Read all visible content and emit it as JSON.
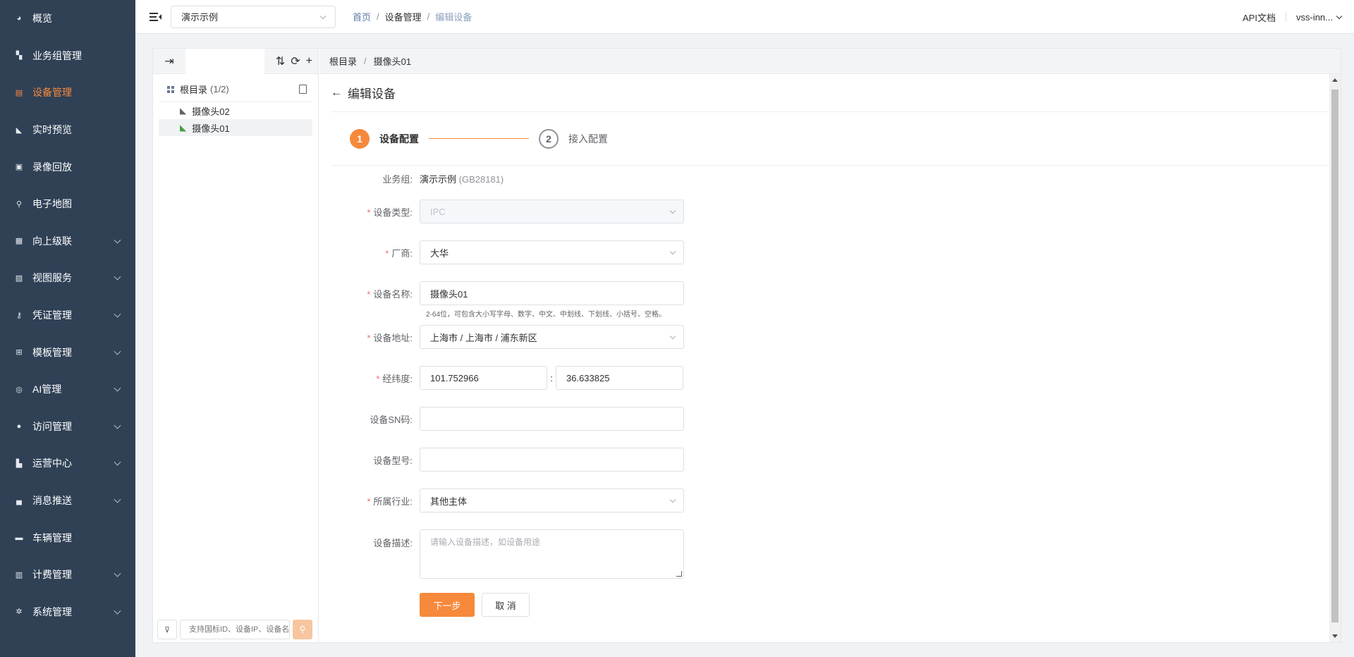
{
  "sidebar": {
    "items": [
      {
        "label": "概览",
        "icon": "dashboard-icon",
        "glyph": "◕",
        "expandable": false,
        "active": false
      },
      {
        "label": "业务组管理",
        "icon": "org-icon",
        "glyph": "▚",
        "expandable": false,
        "active": false
      },
      {
        "label": "设备管理",
        "icon": "device-icon",
        "glyph": "▤",
        "expandable": false,
        "active": true
      },
      {
        "label": "实时预览",
        "icon": "camera-icon",
        "glyph": "◣",
        "expandable": false,
        "active": false
      },
      {
        "label": "录像回放",
        "icon": "video-icon",
        "glyph": "▣",
        "expandable": false,
        "active": false
      },
      {
        "label": "电子地图",
        "icon": "map-pin-icon",
        "glyph": "⚲",
        "expandable": false,
        "active": false
      },
      {
        "label": "向上级联",
        "icon": "cascade-icon",
        "glyph": "▦",
        "expandable": true,
        "active": false
      },
      {
        "label": "视图服务",
        "icon": "image-icon",
        "glyph": "▨",
        "expandable": true,
        "active": false
      },
      {
        "label": "凭证管理",
        "icon": "key-icon",
        "glyph": "⚷",
        "expandable": true,
        "active": false
      },
      {
        "label": "模板管理",
        "icon": "template-icon",
        "glyph": "⊞",
        "expandable": true,
        "active": false
      },
      {
        "label": "AI管理",
        "icon": "ai-icon",
        "glyph": "◎",
        "expandable": true,
        "active": false
      },
      {
        "label": "访问管理",
        "icon": "user-icon",
        "glyph": "●",
        "expandable": true,
        "active": false
      },
      {
        "label": "运营中心",
        "icon": "building-icon",
        "glyph": "▙",
        "expandable": true,
        "active": false
      },
      {
        "label": "消息推送",
        "icon": "inbox-icon",
        "glyph": "▄",
        "expandable": true,
        "active": false
      },
      {
        "label": "车辆管理",
        "icon": "car-icon",
        "glyph": "▬",
        "expandable": false,
        "active": false
      },
      {
        "label": "计费管理",
        "icon": "billing-icon",
        "glyph": "▥",
        "expandable": true,
        "active": false
      },
      {
        "label": "系统管理",
        "icon": "settings-icon",
        "glyph": "✲",
        "expandable": true,
        "active": false
      }
    ]
  },
  "topbar": {
    "org_select": "演示示例",
    "breadcrumb": [
      "首页",
      "设备管理",
      "编辑设备"
    ],
    "api_docs": "API文档",
    "user": "vss-inn..."
  },
  "tree": {
    "root_label": "根目录",
    "root_count": "(1/2)",
    "nodes": [
      {
        "label": "摄像头02",
        "online": false,
        "selected": false
      },
      {
        "label": "摄像头01",
        "online": true,
        "selected": true
      }
    ],
    "search_placeholder": "支持国标ID、设备IP、设备名称"
  },
  "right_breadcrumb": [
    "根目录",
    "摄像头01"
  ],
  "edit": {
    "title": "编辑设备",
    "steps": [
      {
        "num": "1",
        "label": "设备配置"
      },
      {
        "num": "2",
        "label": "接入配置"
      }
    ]
  },
  "form": {
    "business_group_label": "业务组:",
    "business_group_value": "演示示例",
    "business_group_suffix": "(GB28181)",
    "device_type_label": "设备类型:",
    "device_type_value": "IPC",
    "vendor_label": "厂商:",
    "vendor_value": "大华",
    "device_name_label": "设备名称:",
    "device_name_value": "摄像头01",
    "device_name_hint": "2-64位，可包含大小写字母、数字、中文、中划线、下划线、小括号、空格。",
    "address_label": "设备地址:",
    "address_value": "上海市 / 上海市 / 浦东新区",
    "latlng_label": "经纬度:",
    "lng_value": "101.752966",
    "lat_value": "36.633825",
    "latlng_sep": ":",
    "sn_label": "设备SN码:",
    "sn_value": "",
    "model_label": "设备型号:",
    "model_value": "",
    "industry_label": "所属行业:",
    "industry_value": "其他主体",
    "desc_label": "设备描述:",
    "desc_placeholder": "请输入设备描述，如设备用途",
    "next_button": "下一步",
    "cancel_button": "取 消",
    "required_mark": "*"
  },
  "colors": {
    "sidebar_bg": "#304156",
    "accent": "#f6893b",
    "required": "#f56c6c"
  }
}
